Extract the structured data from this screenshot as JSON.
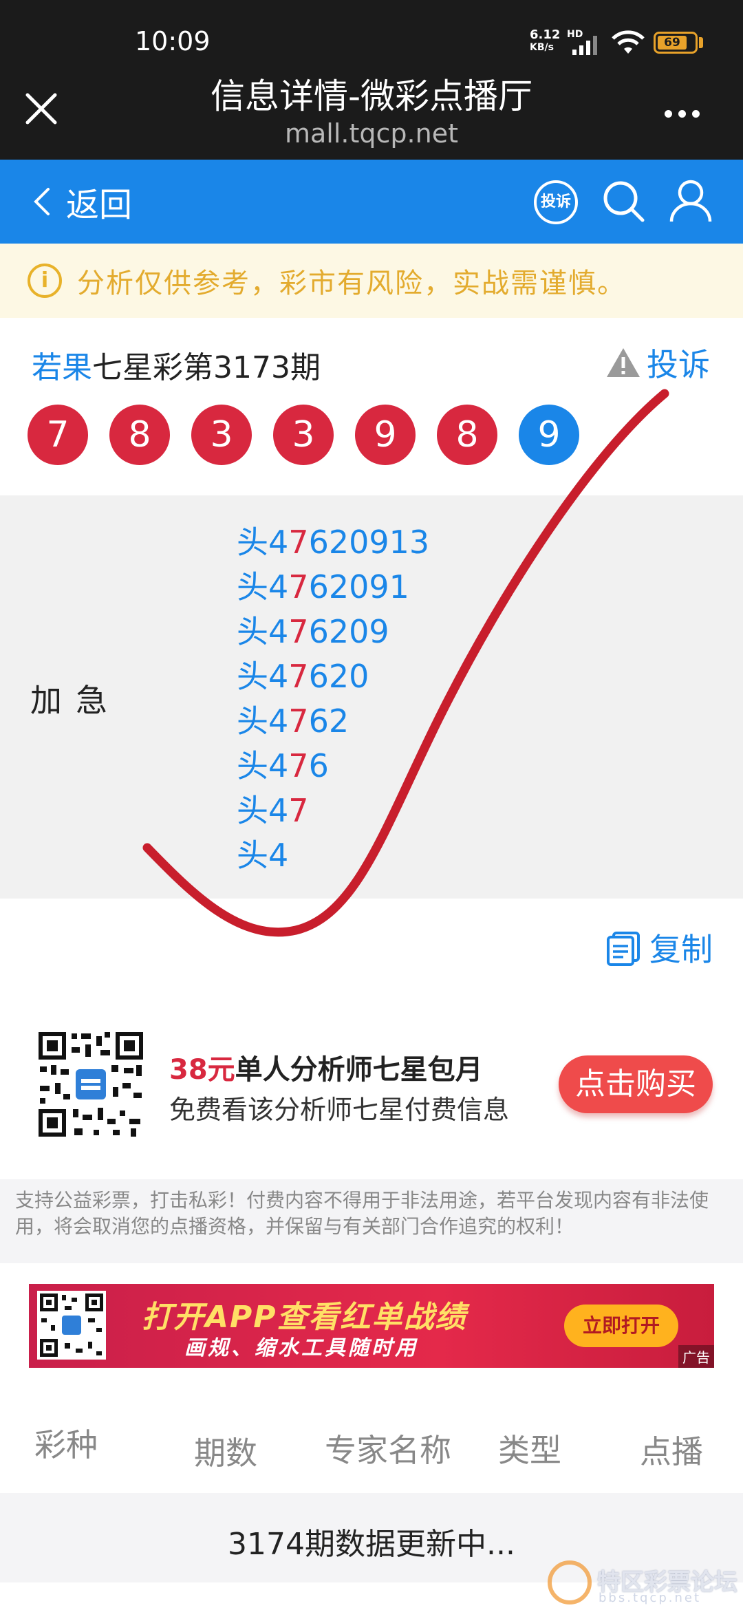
{
  "status_bar": {
    "time": "10:09",
    "net_speed_top": "6.12",
    "net_speed_unit": "KB/s",
    "hd": "HD",
    "battery": "69"
  },
  "title_bar": {
    "title": "信息详情-微彩点播厅",
    "url": "mall.tqcp.net"
  },
  "nav": {
    "back_label": "返回",
    "complain_icon_label": "投诉"
  },
  "warning": {
    "text": "分析仅供参考，彩市有风险，实战需谨慎。"
  },
  "lottery": {
    "author": "若果",
    "title": "七星彩第3173期",
    "report_label": "投诉",
    "balls": [
      "7",
      "8",
      "3",
      "3",
      "9",
      "8",
      "9"
    ],
    "ball_colors": {
      "red": "#d8283f",
      "blue": "#1a86e8"
    }
  },
  "content": {
    "label": "加急",
    "lines": [
      {
        "prefix": "头4",
        "red": "7",
        "rest": "620913"
      },
      {
        "prefix": "头4",
        "red": "7",
        "rest": "62091"
      },
      {
        "prefix": "头4",
        "red": "7",
        "rest": "6209"
      },
      {
        "prefix": "头4",
        "red": "7",
        "rest": "620"
      },
      {
        "prefix": "头4",
        "red": "7",
        "rest": "62"
      },
      {
        "prefix": "头4",
        "red": "7",
        "rest": "6"
      },
      {
        "prefix": "头4",
        "red": "7",
        "rest": ""
      },
      {
        "prefix": "头4",
        "red": "",
        "rest": ""
      }
    ],
    "copy_label": "复制"
  },
  "promo": {
    "price": "38元",
    "desc": "单人分析师七星包月",
    "subtitle": "免费看该分析师七星付费信息",
    "buy_label": "点击购买"
  },
  "disclaimer": "支持公益彩票，打击私彩！付费内容不得用于非法用途，若平台发现内容有非法使用，将会取消您的点播资格，并保留与有关部门合作追究的权利！",
  "banner": {
    "title": "打开APP查看红单战绩",
    "subtitle": "画规、缩水工具随时用",
    "open_label": "立即打开",
    "ad_label": "广告"
  },
  "table": {
    "headers": [
      "彩种",
      "期数",
      "专家名称",
      "类型",
      "点播"
    ],
    "status": "3174期数据更新中..."
  },
  "watermark": {
    "text": "特区彩票论坛",
    "url": "bbs.tqcp.net"
  }
}
